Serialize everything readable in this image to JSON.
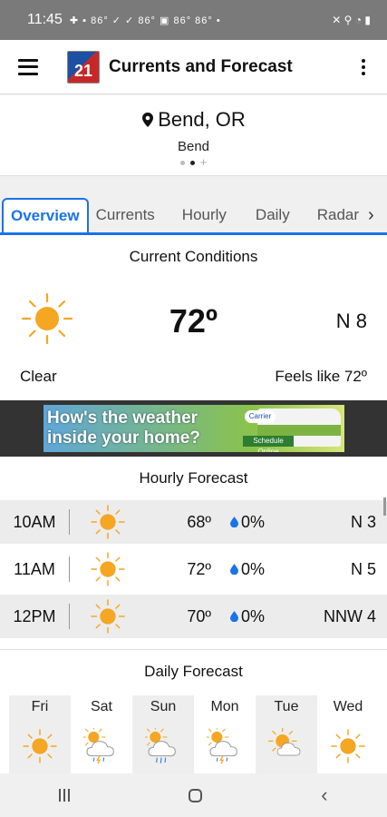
{
  "status_bar": {
    "time": "11:45",
    "indicators": "✚ ▪ 86° ✓ ✓ 86° ▣ 86° 86° •",
    "right_icons": "✕ ⚲ ◔ ▮"
  },
  "app_bar": {
    "logo_text": "21",
    "title": "Currents and Forecast"
  },
  "location": {
    "name": "Bend, OR",
    "subtitle": "Bend",
    "add_symbol": "+"
  },
  "tabs": [
    {
      "label": "Overview",
      "active": true
    },
    {
      "label": "Currents",
      "active": false
    },
    {
      "label": "Hourly",
      "active": false
    },
    {
      "label": "Daily",
      "active": false
    },
    {
      "label": "Radar",
      "active": false
    }
  ],
  "current_conditions": {
    "heading": "Current Conditions",
    "icon": "sun-icon",
    "temperature": "72º",
    "wind": "N  8",
    "condition": "Clear",
    "feels_like": "Feels like 72º"
  },
  "ad": {
    "line1": "How's the weather",
    "line2": "inside your home?",
    "brand": "Carrier",
    "cta": "Schedule Online"
  },
  "hourly": {
    "heading": "Hourly Forecast",
    "rows": [
      {
        "time": "10AM",
        "icon": "sun-icon",
        "temp": "68º",
        "precip": "0%",
        "wind": "N  3"
      },
      {
        "time": "11AM",
        "icon": "sun-icon",
        "temp": "72º",
        "precip": "0%",
        "wind": "N  5"
      },
      {
        "time": "12PM",
        "icon": "sun-icon",
        "temp": "70º",
        "precip": "0%",
        "wind": "NNW  4"
      }
    ]
  },
  "daily": {
    "heading": "Daily Forecast",
    "days": [
      {
        "name": "Fri",
        "icon": "sun-icon"
      },
      {
        "name": "Sat",
        "icon": "thunderstorm-icon"
      },
      {
        "name": "Sun",
        "icon": "rain-icon"
      },
      {
        "name": "Mon",
        "icon": "thunderstorm-icon"
      },
      {
        "name": "Tue",
        "icon": "partly-cloudy-icon"
      },
      {
        "name": "Wed",
        "icon": "sun-icon"
      }
    ]
  },
  "colors": {
    "accent": "#1a73e8",
    "sun": "#f5a623",
    "drop": "#1a73e8"
  }
}
